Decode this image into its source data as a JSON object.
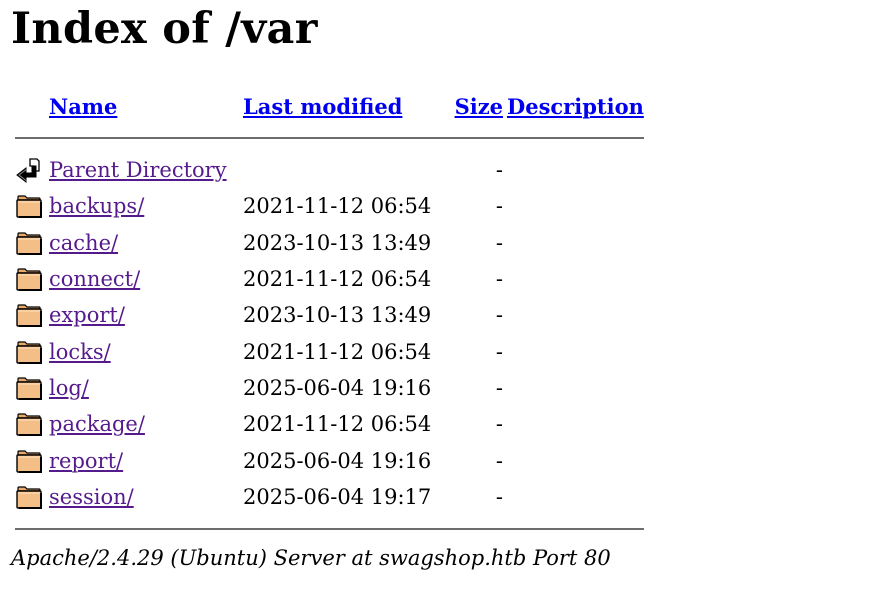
{
  "page": {
    "title": "Index of /var"
  },
  "table": {
    "headers": {
      "name": "Name",
      "last_modified": "Last modified",
      "size": "Size",
      "description": "Description"
    },
    "rows": [
      {
        "name": "Parent Directory",
        "modified": "",
        "size": "-",
        "desc": "",
        "icon": "back-icon"
      },
      {
        "name": "backups/",
        "modified": "2021-11-12 06:54",
        "size": "-",
        "desc": "",
        "icon": "folder-icon"
      },
      {
        "name": "cache/",
        "modified": "2023-10-13 13:49",
        "size": "-",
        "desc": "",
        "icon": "folder-icon"
      },
      {
        "name": "connect/",
        "modified": "2021-11-12 06:54",
        "size": "-",
        "desc": "",
        "icon": "folder-icon"
      },
      {
        "name": "export/",
        "modified": "2023-10-13 13:49",
        "size": "-",
        "desc": "",
        "icon": "folder-icon"
      },
      {
        "name": "locks/",
        "modified": "2021-11-12 06:54",
        "size": "-",
        "desc": "",
        "icon": "folder-icon"
      },
      {
        "name": "log/",
        "modified": "2025-06-04 19:16",
        "size": "-",
        "desc": "",
        "icon": "folder-icon"
      },
      {
        "name": "package/",
        "modified": "2021-11-12 06:54",
        "size": "-",
        "desc": "",
        "icon": "folder-icon"
      },
      {
        "name": "report/",
        "modified": "2025-06-04 19:16",
        "size": "-",
        "desc": "",
        "icon": "folder-icon"
      },
      {
        "name": "session/",
        "modified": "2025-06-04 19:17",
        "size": "-",
        "desc": "",
        "icon": "folder-icon"
      }
    ]
  },
  "footer": {
    "server_signature": "Apache/2.4.29 (Ubuntu) Server at swagshop.htb Port 80"
  },
  "colors": {
    "link": "#0000ee",
    "visited_link": "#551a8b",
    "rule": "#6d6d6d",
    "folder_fill": "#f4bf86",
    "folder_outline": "#000000"
  }
}
